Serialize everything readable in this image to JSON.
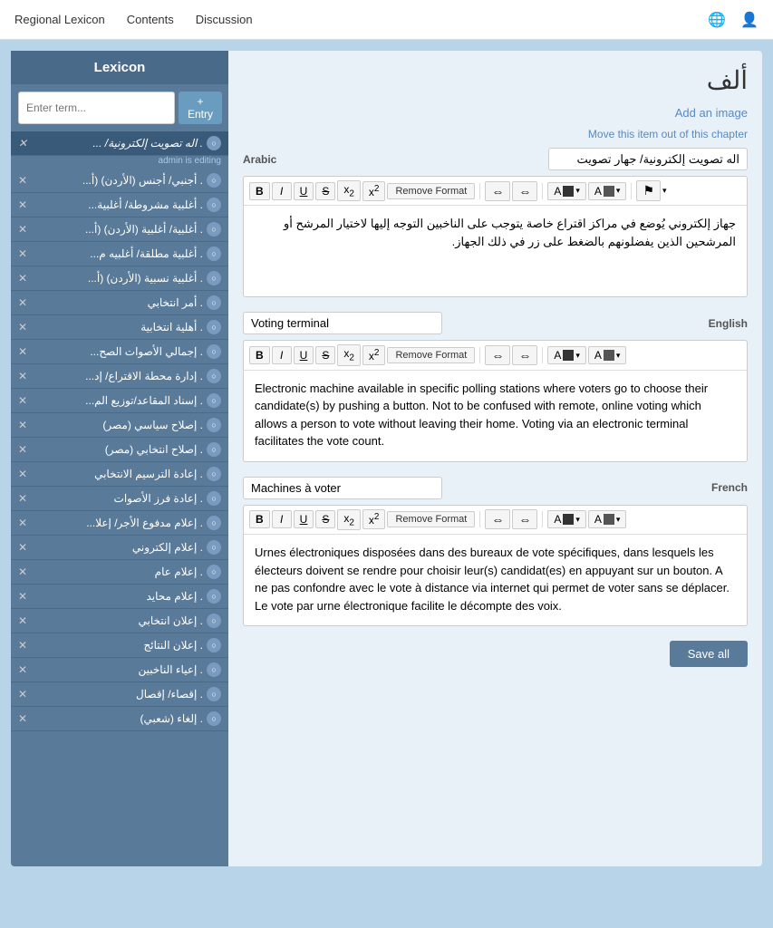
{
  "topnav": {
    "links": [
      {
        "id": "regional-lexicon",
        "label": "Regional Lexicon"
      },
      {
        "id": "contents",
        "label": "Contents"
      },
      {
        "id": "discussion",
        "label": "Discussion"
      }
    ],
    "globe_icon": "🌐",
    "user_icon": "👤"
  },
  "sidebar": {
    "title": "Lexicon",
    "search_placeholder": "Enter term...",
    "add_entry_label": "+ Entry",
    "items": [
      {
        "id": "item-1",
        "text": "اله تصويت إلكترونية/ ...",
        "editing": true
      },
      {
        "id": "item-1-admin",
        "text": "admin is editing",
        "isAdmin": true
      },
      {
        "id": "item-2",
        "text": "أجنبي/ أجنس (الأردن) (أ..."
      },
      {
        "id": "item-3",
        "text": "أغلبية مشروطة/ أغلبية..."
      },
      {
        "id": "item-4",
        "text": "أغلبية/ أغلبية (الأردن) (أ..."
      },
      {
        "id": "item-5",
        "text": "أغلبية مطلقة/ أغلبيه م..."
      },
      {
        "id": "item-6",
        "text": "أغلبية نسبية (الأردن) (أ..."
      },
      {
        "id": "item-7",
        "text": "أمر انتخابي"
      },
      {
        "id": "item-8",
        "text": "أهلية انتخابية"
      },
      {
        "id": "item-9",
        "text": "إجمالي الأصوات الصح..."
      },
      {
        "id": "item-10",
        "text": "إدارة محطة الاقتراع/ إد..."
      },
      {
        "id": "item-11",
        "text": "إسناد المقاعد/توزيع الم..."
      },
      {
        "id": "item-12",
        "text": "إصلاح سياسي (مصر)"
      },
      {
        "id": "item-13",
        "text": "إصلاح انتخابي (مصر)"
      },
      {
        "id": "item-14",
        "text": "إعادة الترسيم الانتخابي"
      },
      {
        "id": "item-15",
        "text": "إعادة فرز الأصوات"
      },
      {
        "id": "item-16",
        "text": "إعلام مدفوع الأجر/ إعلا..."
      },
      {
        "id": "item-17",
        "text": "إعلام إلكتروني"
      },
      {
        "id": "item-18",
        "text": "إعلام عام"
      },
      {
        "id": "item-19",
        "text": "إعلام محايد"
      },
      {
        "id": "item-20",
        "text": "إعلان انتخابي"
      },
      {
        "id": "item-21",
        "text": "إعلان النتائج"
      },
      {
        "id": "item-22",
        "text": "إعياء الناخبين"
      },
      {
        "id": "item-23",
        "text": "إقصاء/ إقصال"
      },
      {
        "id": "item-24",
        "text": "إلغاء (شعبي)"
      }
    ]
  },
  "content": {
    "page_title": "ألف",
    "add_image_label": "Add an image",
    "move_item_label": "Move this item out of this chapter",
    "sections": [
      {
        "id": "arabic-section",
        "lang_label": "Arabic",
        "term_value": "اله تصويت إلكترونية/ جهار تصويت",
        "is_rtl": true,
        "body_text": "جهاز إلكتروني يُوضع في مراكز اقتراع خاصة يتوجب على الناخبين التوجه إليها لاختيار المرشح أو المرشحين الذين يفضلونهم بالضغط على زر في ذلك الجهاز."
      },
      {
        "id": "english-section",
        "lang_label": "English",
        "term_value": "Voting terminal",
        "is_rtl": false,
        "body_text": "Electronic machine available in specific polling stations where voters go to choose their candidate(s) by pushing a button. Not to be confused with remote, online voting which allows a person to vote without leaving their home. Voting via an electronic terminal facilitates the vote count."
      },
      {
        "id": "french-section",
        "lang_label": "French",
        "term_value": "Machines à voter",
        "is_rtl": false,
        "body_text": "Urnes électroniques disposées dans des bureaux de vote spécifiques, dans lesquels les électeurs doivent se rendre pour choisir leur(s) candidat(es) en appuyant sur un bouton. A ne pas confondre avec le vote à distance via internet qui permet de voter sans se déplacer. Le vote par urne électronique facilite le décompte des voix."
      }
    ],
    "save_all_label": "Save all"
  },
  "toolbar": {
    "bold": "B",
    "italic": "I",
    "underline": "U",
    "strikethrough": "S",
    "subscript": "x₂",
    "superscript": "x²",
    "remove_format": "Remove Format",
    "align_left": "≡",
    "align_right": "≡",
    "font_color": "A",
    "bg_color": "A",
    "flag": "⚑"
  }
}
